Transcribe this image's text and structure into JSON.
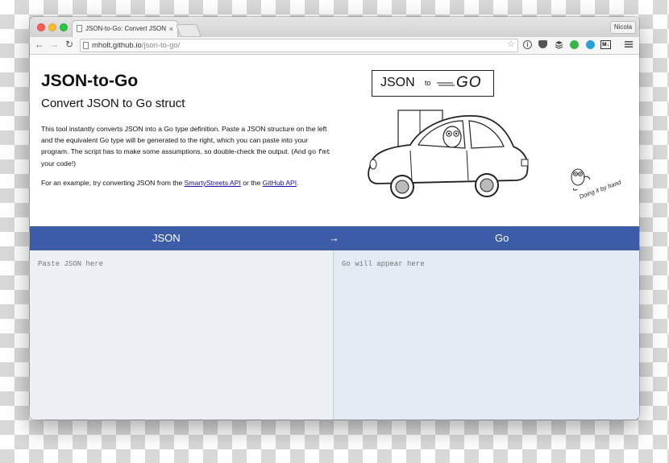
{
  "browser": {
    "tab_title": "JSON-to-Go: Convert JSON",
    "tab_close": "×",
    "user_name": "Nicola",
    "url_host": "mholt.github.io",
    "url_path": "/json-to-go/",
    "nav": {
      "back": "←",
      "forward": "→",
      "reload": "↻"
    },
    "extensions": [
      "info-icon",
      "pocket-icon",
      "buffer-icon",
      "green-circle-icon",
      "blue-shield-icon",
      "markdown-icon",
      "menu-icon"
    ],
    "ext_markdown_label": "M↓"
  },
  "page": {
    "title": "JSON-to-Go",
    "subtitle": "Convert JSON to Go struct",
    "description": {
      "before_code1": "This tool instantly converts JSON into a Go type definition. Paste a JSON structure on the left and the equivalent Go type will be generated to the right, which you can paste into your program. The script has to make some assumptions, so double-check the output. (And ",
      "code1": "go",
      "code2": "fmt",
      "after_code": " your code!)"
    },
    "example": {
      "prefix": "For an example, try converting JSON from the ",
      "link1": "SmartyStreets API",
      "middle": " or the ",
      "link2": "GitHub API",
      "suffix": "."
    },
    "logo": {
      "json": "JSON",
      "to": "to",
      "go": "GO"
    },
    "tagline": "Doing it by hand"
  },
  "bar": {
    "left_label": "JSON",
    "arrow": "→",
    "right_label": "Go"
  },
  "editor": {
    "json_placeholder": "Paste JSON here",
    "go_placeholder": "Go will appear here"
  },
  "colors": {
    "bar": "#3d5ca8",
    "json_pane": "#edf1f6",
    "go_pane": "#e3ebf5"
  }
}
